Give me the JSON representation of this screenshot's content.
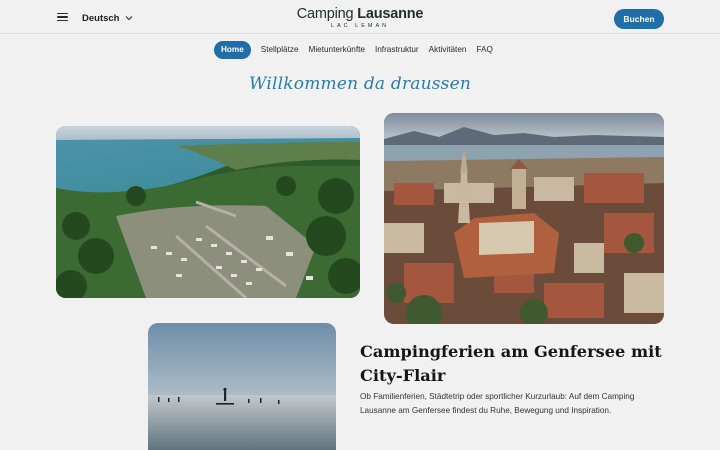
{
  "header": {
    "language": "Deutsch",
    "logo": {
      "main_light": "Camping ",
      "main_bold": "Lausanne",
      "sub": "LAC LEMAN"
    },
    "book_label": "Buchen"
  },
  "nav": {
    "items": [
      {
        "label": "Home",
        "active": true
      },
      {
        "label": "Stellplätze",
        "active": false
      },
      {
        "label": "Mietunterkünfte",
        "active": false
      },
      {
        "label": "Infrastruktur",
        "active": false
      },
      {
        "label": "Aktivitäten",
        "active": false
      },
      {
        "label": "FAQ",
        "active": false
      }
    ]
  },
  "hero": {
    "script_title": "Willkommen da draussen"
  },
  "content": {
    "headline": "Campingferien am Genfersee mit City-Flair",
    "text": "Ob Familienferien, Städtetrip oder sportlicher Kurzurlaub: Auf dem Camping Lausanne am Genfersee findest du Ruhe, Bewegung und Inspiration."
  },
  "colors": {
    "accent": "#1f6ea9",
    "script": "#2c7cab",
    "background": "#f1f1f2"
  },
  "icons": {
    "menu": "hamburger-icon",
    "language": "chevron-down-icon"
  }
}
